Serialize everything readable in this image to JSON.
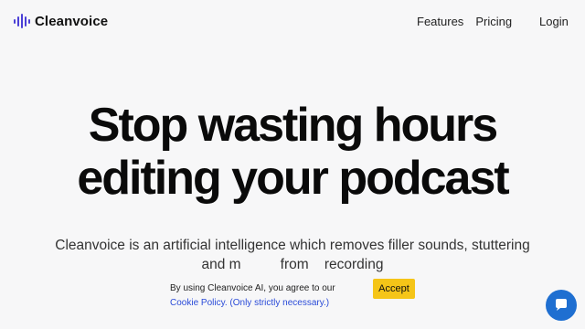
{
  "brand": {
    "name": "Cleanvoice",
    "logo_icon": "soundwave-bars-icon",
    "accent_color": "#4b3fd6"
  },
  "nav": {
    "features_label": "Features",
    "pricing_label": "Pricing",
    "login_label": "Login"
  },
  "hero": {
    "title_line1": "Stop wasting hours",
    "title_line2": "editing your podcast",
    "subtitle_line1": "Cleanvoice is an artificial intelligence which removes filler sounds, stuttering",
    "subtitle_line2": "and m          from    recording"
  },
  "cookie_banner": {
    "text": "By using Cleanvoice AI, you agree to our",
    "policy_link": "Cookie Policy.",
    "note": "(Only strictly necessary.)",
    "accept_label": "Accept",
    "accept_color": "#f5c518"
  },
  "chat": {
    "icon": "chat-bubble-icon",
    "color": "#1f6fd1"
  }
}
